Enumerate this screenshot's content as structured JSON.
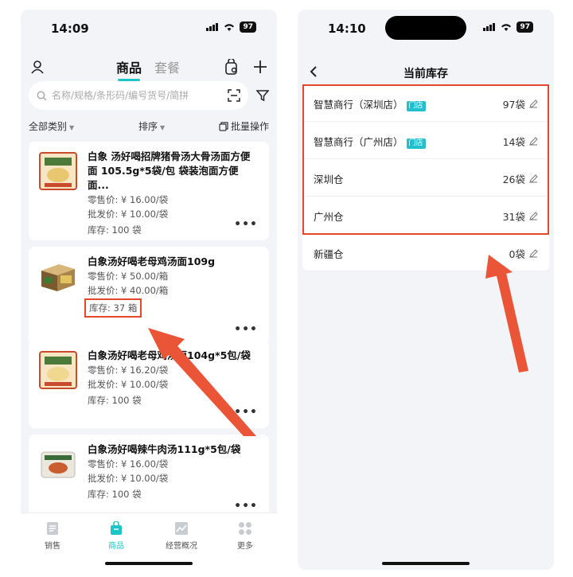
{
  "left_screen": {
    "status": {
      "time": "14:09",
      "battery": "97"
    },
    "tabs": [
      {
        "label": "商品",
        "active": true
      },
      {
        "label": "套餐",
        "active": false
      }
    ],
    "search": {
      "placeholder": "名称/规格/条形码/编号货号/简拼"
    },
    "filters": {
      "category": "全部类别",
      "sort": "排序",
      "batch": "批量操作"
    },
    "products": [
      {
        "name": "白象 汤好喝招牌猪骨汤大骨汤面方便面 105.5g*5袋/包 袋装泡面方便面...",
        "retail": "零售价: ¥ 16.00/袋",
        "wholesale": "批发价: ¥ 10.00/袋",
        "stock": "库存: 100 袋"
      },
      {
        "name": "白象汤好喝老母鸡汤面109g",
        "retail": "零售价: ¥ 50.00/箱",
        "wholesale": "批发价: ¥ 40.00/箱",
        "stock": "库存: 37 箱"
      },
      {
        "name": "白象汤好喝老母鸡汤面104g*5包/袋",
        "retail": "零售价: ¥ 16.20/袋",
        "wholesale": "批发价: ¥ 10.00/袋",
        "stock": "库存: 100 袋"
      },
      {
        "name": "白象汤好喝辣牛肉汤111g*5包/袋",
        "retail": "零售价: ¥ 16.00/袋",
        "wholesale": "批发价: ¥ 10.00/袋",
        "stock": "库存: 100 袋"
      }
    ],
    "nav": [
      {
        "label": "销售",
        "icon": "sales-icon"
      },
      {
        "label": "商品",
        "icon": "goods-icon",
        "active": true
      },
      {
        "label": "经营概况",
        "icon": "chart-icon"
      },
      {
        "label": "更多",
        "icon": "grid-icon"
      }
    ],
    "colors": {
      "accent": "#1fc5c5",
      "highlight": "#e5472d"
    }
  },
  "right_screen": {
    "status": {
      "time": "14:10",
      "battery": "97"
    },
    "title": "当前库存",
    "stores": [
      {
        "name": "智慧商行（深圳店）",
        "tag": "门店",
        "qty": "97袋"
      },
      {
        "name": "智慧商行（广州店）",
        "tag": "门店",
        "qty": "14袋"
      },
      {
        "name": "深圳仓",
        "tag": "",
        "qty": "26袋"
      },
      {
        "name": "广州仓",
        "tag": "",
        "qty": "31袋"
      },
      {
        "name": "新疆仓",
        "tag": "",
        "qty": "0袋"
      }
    ]
  }
}
